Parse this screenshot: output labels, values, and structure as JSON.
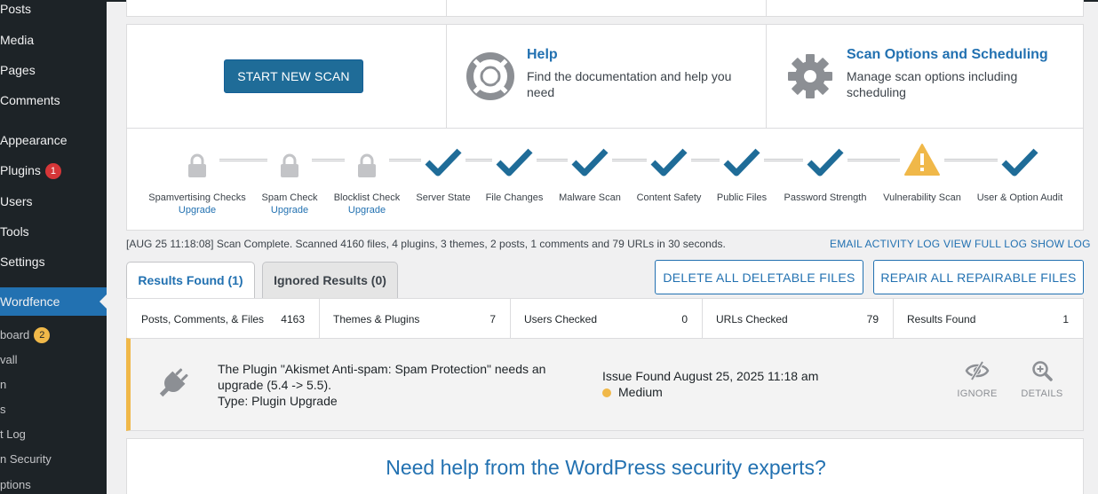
{
  "sidebar": {
    "items": [
      {
        "label": "Posts",
        "badge": ""
      },
      {
        "label": "Media",
        "badge": ""
      },
      {
        "label": "Pages",
        "badge": ""
      },
      {
        "label": "Comments",
        "badge": ""
      },
      {
        "label": "Appearance",
        "badge": ""
      },
      {
        "label": "Plugins",
        "badge": "1"
      },
      {
        "label": "Users",
        "badge": ""
      },
      {
        "label": "Tools",
        "badge": ""
      },
      {
        "label": "Settings",
        "badge": ""
      },
      {
        "label": "Wordfence",
        "badge": ""
      }
    ],
    "subitems": [
      {
        "label": "board",
        "badge": "2"
      },
      {
        "label": "vall",
        "badge": ""
      },
      {
        "label": "n",
        "badge": ""
      },
      {
        "label": "s",
        "badge": ""
      },
      {
        "label": "t Log",
        "badge": ""
      },
      {
        "label": "n Security",
        "badge": ""
      },
      {
        "label": "ptions",
        "badge": ""
      }
    ]
  },
  "actions": {
    "start_scan_label": "START NEW SCAN",
    "help_title": "Help",
    "help_desc": "Find the documentation and help you need",
    "options_title": "Scan Options and Scheduling",
    "options_desc": "Manage scan options including scheduling"
  },
  "stages": [
    {
      "label": "Spamvertising Checks",
      "upgrade": "Upgrade",
      "status": "locked"
    },
    {
      "label": "Spam Check",
      "upgrade": "Upgrade",
      "status": "locked"
    },
    {
      "label": "Blocklist Check",
      "upgrade": "Upgrade",
      "status": "locked"
    },
    {
      "label": "Server State",
      "upgrade": "",
      "status": "complete"
    },
    {
      "label": "File Changes",
      "upgrade": "",
      "status": "complete"
    },
    {
      "label": "Malware Scan",
      "upgrade": "",
      "status": "complete"
    },
    {
      "label": "Content Safety",
      "upgrade": "",
      "status": "complete"
    },
    {
      "label": "Public Files",
      "upgrade": "",
      "status": "complete"
    },
    {
      "label": "Password Strength",
      "upgrade": "",
      "status": "complete"
    },
    {
      "label": "Vulnerability Scan",
      "upgrade": "",
      "status": "warning"
    },
    {
      "label": "User & Option Audit",
      "upgrade": "",
      "status": "complete"
    }
  ],
  "log": {
    "message": "[AUG 25 11:18:08] Scan Complete. Scanned 4160 files, 4 plugins, 3 themes, 2 posts, 1 comments and 79 URLs in 30 seconds.",
    "email_label": "EMAIL ACTIVITY LOG",
    "full_label": "VIEW FULL LOG",
    "show_label": "SHOW LOG"
  },
  "tabs": {
    "results": "Results Found (1)",
    "ignored": "Ignored Results (0)"
  },
  "bulk": {
    "delete_label": "DELETE ALL DELETABLE FILES",
    "repair_label": "REPAIR ALL REPAIRABLE FILES"
  },
  "summary": [
    {
      "label": "Posts, Comments, & Files",
      "value": "4163"
    },
    {
      "label": "Themes & Plugins",
      "value": "7"
    },
    {
      "label": "Users Checked",
      "value": "0"
    },
    {
      "label": "URLs Checked",
      "value": "79"
    },
    {
      "label": "Results Found",
      "value": "1"
    }
  ],
  "issue": {
    "title": "The Plugin \"Akismet Anti-spam: Spam Protection\" needs an upgrade (5.4 -> 5.5).",
    "type": "Type: Plugin Upgrade",
    "found": "Issue Found August 25, 2025 11:18 am",
    "severity": "Medium",
    "ignore_label": "IGNORE",
    "details_label": "DETAILS"
  },
  "help_heading": "Need help from the WordPress security experts?",
  "colors": {
    "accent": "#2271b1",
    "complete": "#1f6c98",
    "warning": "#f0b849",
    "locked": "#c3c4c7"
  },
  "icons": {
    "lock": "lock-icon",
    "check": "checkmark-icon",
    "warning": "warning-icon",
    "help": "lifebuoy-icon",
    "options": "gear-icon",
    "plugin": "plug-icon",
    "ignore": "eye-slash-icon",
    "details": "zoom-in-icon"
  }
}
